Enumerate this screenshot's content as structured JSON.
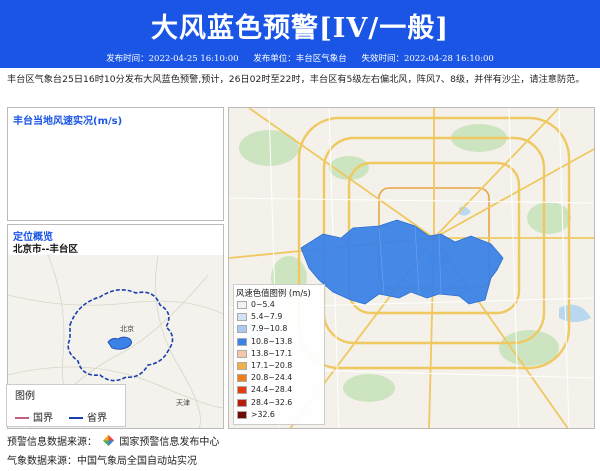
{
  "header": {
    "title": "大风蓝色预警[IV/一般]",
    "issue_time": "发布时间：2022-04-25 16:10:00",
    "issuer": "发布单位：丰台区气象台",
    "expire_time": "失效时间：2022-04-28 16:10:00"
  },
  "content": "丰台区气象台25日16时10分发布大风蓝色预警,预计，26日02时至22时，丰台区有5级左右偏北风，阵风7、8级，并伴有沙尘，请注意防范。",
  "wind_panel": {
    "title": "丰台当地风速实况(m/s)"
  },
  "location_panel": {
    "title": "定位概览",
    "subtitle": "北京市--丰台区",
    "map_labels": {
      "beijing": "北京",
      "tianjin": "天津"
    },
    "legend": {
      "title": "图例",
      "items": [
        {
          "label": "国界",
          "color": "#c0607e"
        },
        {
          "label": "省界",
          "color": "#1a3fb0"
        }
      ]
    }
  },
  "wind_scale": {
    "title": "风速色值图例 (m/s)",
    "items": [
      {
        "label": "0~5.4",
        "color": "#f2f2f2"
      },
      {
        "label": "5.4~7.9",
        "color": "#d3e3f6"
      },
      {
        "label": "7.9~10.8",
        "color": "#a9c9ee"
      },
      {
        "label": "10.8~13.8",
        "color": "#3b82e6"
      },
      {
        "label": "13.8~17.1",
        "color": "#f4c7a8"
      },
      {
        "label": "17.1~20.8",
        "color": "#f0b04c"
      },
      {
        "label": "20.8~24.4",
        "color": "#ee7d1a"
      },
      {
        "label": "24.4~28.4",
        "color": "#e33c12"
      },
      {
        "label": "28.4~32.6",
        "color": "#b51c0c"
      },
      {
        "label": ">32.6",
        "color": "#6e0b05"
      }
    ]
  },
  "footer": {
    "warning_source_label": "预警信息数据来源：",
    "warning_source_name": "国家预警信息发布中心",
    "weather_source": "气象数据来源：中国气象局全国自动站实况"
  }
}
